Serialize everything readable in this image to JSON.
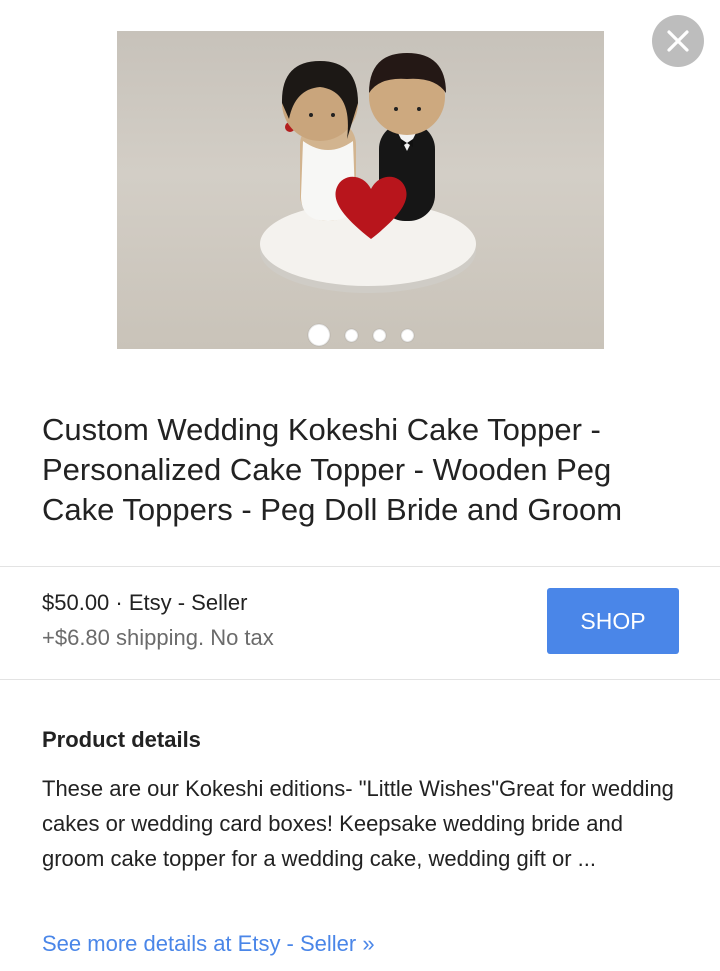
{
  "close_label": "Close",
  "icons": {
    "close": "close-icon"
  },
  "colors": {
    "accent": "#4a86e8",
    "close_bg": "#bdbdbd",
    "muted_text": "#6b6b6b"
  },
  "carousel": {
    "image_alt": "Wooden peg doll bride and groom cake topper with red heart",
    "total_slides": 4,
    "active_index": 0
  },
  "product": {
    "title": "Custom Wedding Kokeshi Cake Topper - Personalized Cake Topper - Wooden Peg Cake Toppers - Peg Doll Bride and Groom",
    "price_line": "$50.00 · Etsy - Seller",
    "shipping_line": "+$6.80 shipping. No tax",
    "shop_label": "SHOP"
  },
  "details": {
    "heading": "Product details",
    "body": "These are our Kokeshi editions- \"Little Wishes\"Great for wedding cakes or wedding card boxes! Keepsake wedding bride and groom cake topper for a wedding cake, wedding gift or ...",
    "more_link": "See more details at Etsy - Seller »"
  }
}
